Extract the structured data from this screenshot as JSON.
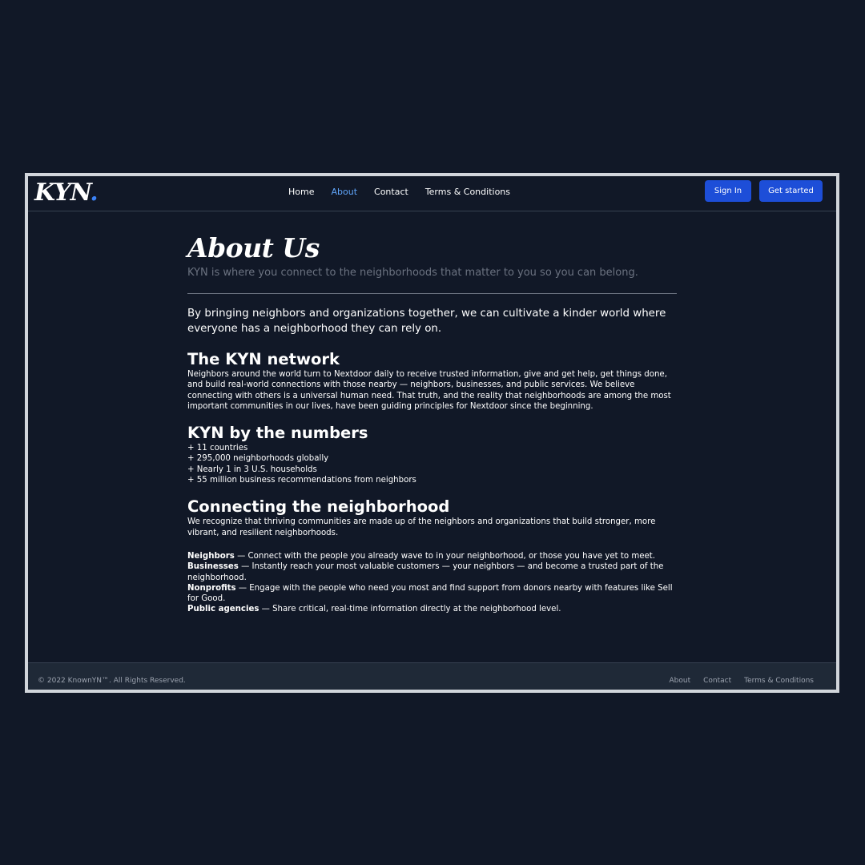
{
  "header": {
    "logo_text": "KYN",
    "logo_dot": ".",
    "nav": [
      {
        "label": "Home",
        "active": false
      },
      {
        "label": "About",
        "active": true
      },
      {
        "label": "Contact",
        "active": false
      },
      {
        "label": "Terms & Conditions",
        "active": false
      }
    ],
    "sign_in_label": "Sign In",
    "get_started_label": "Get started"
  },
  "main": {
    "title": "About Us",
    "subtitle": "KYN is where you connect to the neighborhoods that matter to you so you can belong.",
    "lead": "By bringing neighbors and organizations together, we can cultivate a kinder world where everyone has a neighborhood they can rely on.",
    "network": {
      "heading": "The KYN network",
      "body": "Neighbors around the world turn to Nextdoor daily to receive trusted information, give and get help, get things done, and build real-world connections with those nearby — neighbors, businesses, and public services. We believe connecting with others is a universal human need. That truth, and the reality that neighborhoods are among the most important communities in our lives, have been guiding principles for Nextdoor since the beginning."
    },
    "numbers": {
      "heading": "KYN by the numbers",
      "items": [
        "+ 11 countries",
        "+ 295,000 neighborhoods globally",
        "+ Nearly 1 in 3 U.S. households",
        "+ 55 million business recommendations from neighbors"
      ]
    },
    "connecting": {
      "heading": "Connecting the neighborhood",
      "intro": "We recognize that thriving communities are made up of the neighbors and organizations that build stronger, more vibrant, and resilient neighborhoods.",
      "items": [
        {
          "term": "Neighbors",
          "text": " — Connect with the people you already wave to in your neighborhood, or those you have yet to meet."
        },
        {
          "term": "Businesses",
          "text": " — Instantly reach your most valuable customers — your neighbors — and become a trusted part of the neighborhood."
        },
        {
          "term": "Nonprofits",
          "text": " — Engage with the people who need you most and find support from donors nearby with features like Sell for Good."
        },
        {
          "term": "Public agencies",
          "text": " — Share critical, real-time information directly at the neighborhood level."
        }
      ]
    }
  },
  "footer": {
    "copyright": "© 2022 KnownYN™. All Rights Reserved.",
    "links": [
      "About",
      "Contact",
      "Terms & Conditions"
    ]
  },
  "colors": {
    "background": "#111827",
    "accent": "#1d4ed8",
    "active_link": "#60a5fa",
    "footer_bg": "#1f2937"
  }
}
